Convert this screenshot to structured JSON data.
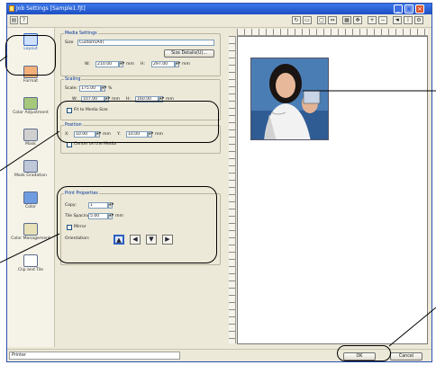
{
  "window": {
    "title": "Job Settings [Sample1.fjt]"
  },
  "nav": {
    "items": [
      {
        "label": "Layout",
        "icon": "layout-icon"
      },
      {
        "label": "Format",
        "icon": "format-icon"
      },
      {
        "label": "Color Adjustment",
        "icon": "color-adjustment-icon"
      },
      {
        "label": "Mask",
        "icon": "mask-icon"
      },
      {
        "label": "Mask Gradation",
        "icon": "mask-gradation-icon"
      },
      {
        "label": "Color",
        "icon": "color-icon"
      },
      {
        "label": "Color Management",
        "icon": "color-management-icon"
      },
      {
        "label": "Clip and Tile",
        "icon": "clip-and-tile-icon"
      }
    ]
  },
  "media": {
    "title": "Media Settings",
    "size_label": "Size",
    "size_value": "Custom(A4)",
    "size_detail_button": "Size Details(U)...",
    "w_label": "W:",
    "w_value": "210.00",
    "h_label": "H:",
    "h_value": "297.00",
    "unit": "mm"
  },
  "scaling": {
    "title": "Scaling",
    "scale_label": "Scale:",
    "scale_value": "175.00",
    "percent": "%",
    "w_label": "W:",
    "w_value": "107.00",
    "h_label": "H:",
    "h_value": "160.00",
    "unit": "mm",
    "fit_label": "Fit to Media Size"
  },
  "position": {
    "title": "Position",
    "x_label": "X:",
    "x_value": "10.00",
    "y_label": "Y:",
    "y_value": "10.00",
    "unit": "mm",
    "center_label": "Center on the Media"
  },
  "printcopies": {
    "title": "Print Properties",
    "copies_label": "Copy:",
    "copies_value": "1",
    "spacing_label": "Tile Spacing:",
    "spacing_value": "5.00",
    "unit": "mm",
    "mirror_label": "Mirror",
    "orient_label": "Orientation:"
  },
  "footer": {
    "status": "Printer",
    "ok_label": "OK",
    "cancel_label": "Cancel"
  }
}
